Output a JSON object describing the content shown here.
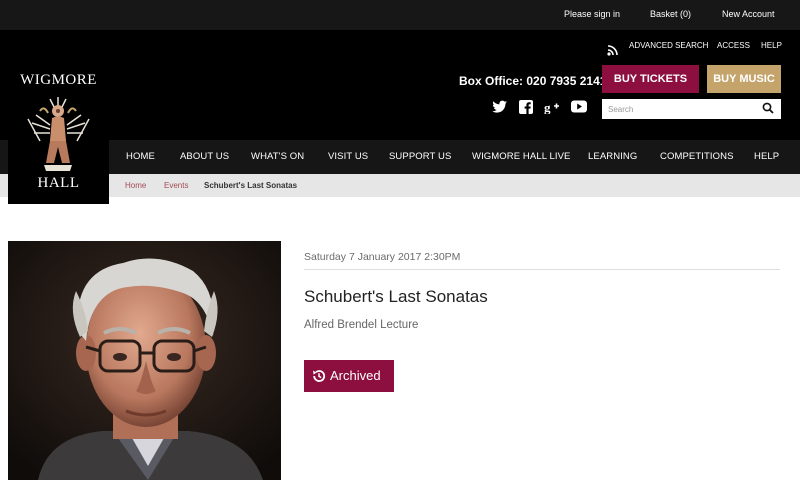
{
  "topbar": {
    "sign_in": "Please sign in",
    "basket": "Basket (0)",
    "new_account": "New Account"
  },
  "utility": {
    "advanced_search": "ADVANCED SEARCH",
    "access": "ACCESS",
    "help": "HELP"
  },
  "logo": {
    "line1": "WIGMORE",
    "line2": "HALL"
  },
  "box_office": "Box Office: 020 7935 2141",
  "buttons": {
    "buy_tickets": "BUY TICKETS",
    "buy_music": "BUY MUSIC"
  },
  "search": {
    "placeholder": "Search"
  },
  "social_icons": [
    "twitter-icon",
    "facebook-icon",
    "google-plus-icon",
    "youtube-icon"
  ],
  "nav": [
    "HOME",
    "ABOUT US",
    "WHAT'S ON",
    "VISIT US",
    "SUPPORT US",
    "WIGMORE HALL LIVE",
    "LEARNING",
    "COMPETITIONS",
    "HELP"
  ],
  "breadcrumb": {
    "home": "Home",
    "events": "Events",
    "current": "Schubert's Last Sonatas"
  },
  "event": {
    "date": "Saturday 7 January 2017 2:30PM",
    "title": "Schubert's Last Sonatas",
    "subtitle": "Alfred Brendel Lecture",
    "status_label": "Archived"
  },
  "colors": {
    "accent": "#8d0f40",
    "gold": "#c4a46b",
    "header": "#000000",
    "nav": "#161616",
    "breadcrumb_bg": "#e6e6e6"
  }
}
